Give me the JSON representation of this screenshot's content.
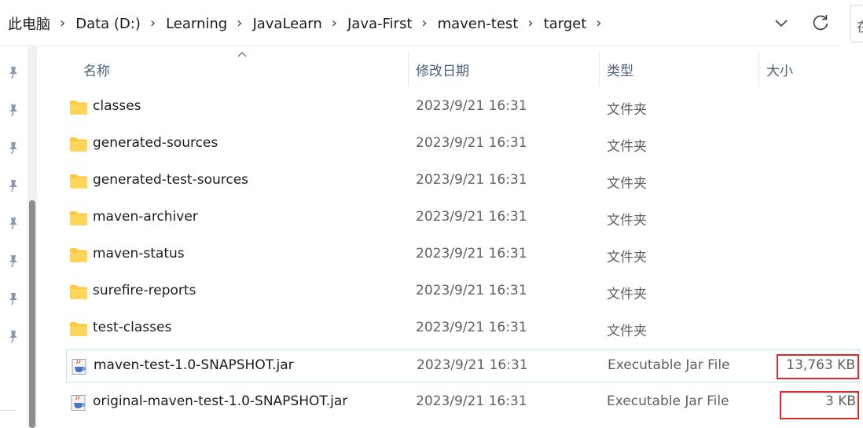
{
  "breadcrumb": [
    "此电脑",
    "Data (D:)",
    "Learning",
    "JavaLearn",
    "Java-First",
    "maven-test",
    "target"
  ],
  "search": {
    "placeholder_fragment": "在"
  },
  "columns": {
    "name": "名称",
    "date": "修改日期",
    "type": "类型",
    "size": "大小"
  },
  "files": [
    {
      "name": "classes",
      "date": "2023/9/21 16:31",
      "type": "文件夹",
      "size": "",
      "icon": "folder-icon"
    },
    {
      "name": "generated-sources",
      "date": "2023/9/21 16:31",
      "type": "文件夹",
      "size": "",
      "icon": "folder-icon"
    },
    {
      "name": "generated-test-sources",
      "date": "2023/9/21 16:31",
      "type": "文件夹",
      "size": "",
      "icon": "folder-icon"
    },
    {
      "name": "maven-archiver",
      "date": "2023/9/21 16:31",
      "type": "文件夹",
      "size": "",
      "icon": "folder-icon"
    },
    {
      "name": "maven-status",
      "date": "2023/9/21 16:31",
      "type": "文件夹",
      "size": "",
      "icon": "folder-icon"
    },
    {
      "name": "surefire-reports",
      "date": "2023/9/21 16:31",
      "type": "文件夹",
      "size": "",
      "icon": "folder-icon"
    },
    {
      "name": "test-classes",
      "date": "2023/9/21 16:31",
      "type": "文件夹",
      "size": "",
      "icon": "folder-icon"
    },
    {
      "name": "maven-test-1.0-SNAPSHOT.jar",
      "date": "2023/9/21 16:31",
      "type": "Executable Jar File",
      "size": "13,763 KB",
      "icon": "jar-file-icon"
    },
    {
      "name": "original-maven-test-1.0-SNAPSHOT.jar",
      "date": "2023/9/21 16:31",
      "type": "Executable Jar File",
      "size": "3 KB",
      "icon": "jar-file-icon"
    }
  ],
  "colors": {
    "folder": "#FFC83D",
    "header_text": "#4C607A",
    "selection_outline": "#BFE3F3",
    "annotation_red": "#E02A2A"
  }
}
